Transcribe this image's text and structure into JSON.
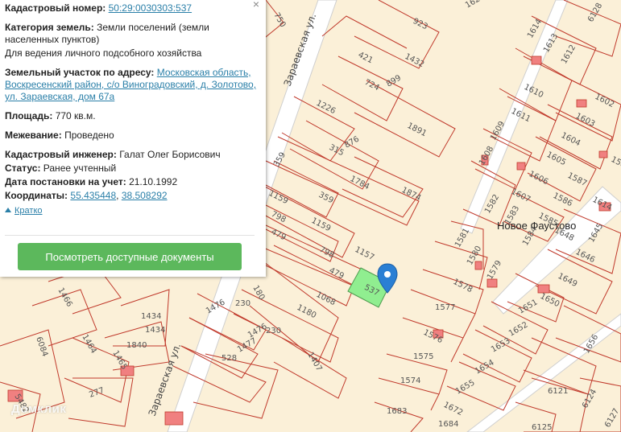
{
  "panel": {
    "cadastral_label": "Кадастровый номер:",
    "cadastral_value": "50:29:0030303:537",
    "category_label": "Категория земель:",
    "category_value": "Земли поселений (земли населенных пунктов)",
    "use_value": "Для ведения личного подсобного хозяйства",
    "address_label": "Земельный участок по адресу:",
    "address_value": "Московская область, Воскресенский район, с/о Виноградовский, д. Золотово, ул. Зараевская, дом 67а",
    "area_label": "Площадь:",
    "area_value": "770 кв.м.",
    "survey_label": "Межевание:",
    "survey_value": "Проведено",
    "engineer_label": "Кадастровый инженер:",
    "engineer_value": "Галат Олег Борисович",
    "status_label": "Статус:",
    "status_value": "Ранее учтенный",
    "date_label": "Дата постановки на учет:",
    "date_value": "21.10.1992",
    "coords_label": "Координаты:",
    "coords_lat": "55.435448",
    "coords_sep": ", ",
    "coords_lon": "38.508292",
    "collapse_label": "Кратко",
    "docs_button": "Посмотреть доступные документы",
    "close_symbol": "×"
  },
  "map": {
    "street_1": "Зараевская ул.",
    "street_2": "Зараевская ул.",
    "place": "Новое Фаустово",
    "selected_plot": "537",
    "watermark": "Домклик",
    "plots": [
      "750",
      "923",
      "1432",
      "421",
      "724",
      "899",
      "1891",
      "1226",
      "876",
      "315",
      "1784",
      "1874",
      "359",
      "359",
      "1159",
      "1159",
      "798",
      "479",
      "798",
      "479",
      "1157",
      "1068",
      "1180",
      "1407",
      "230",
      "230",
      "1476",
      "1476",
      "1477",
      "528",
      "180",
      "1466",
      "1434",
      "1434",
      "1840",
      "1464",
      "1465",
      "6084",
      "277",
      "5482",
      "1683",
      "1684",
      "1672",
      "1574",
      "1575",
      "1576",
      "1577",
      "1578",
      "1579",
      "1580",
      "1581",
      "1582",
      "1583",
      "1584",
      "1585",
      "1586",
      "1587",
      "1588",
      "1602",
      "1603",
      "1604",
      "1605",
      "1606",
      "1607",
      "1608",
      "1609",
      "1610",
      "1611",
      "1612",
      "1613",
      "1614",
      "1614",
      "1645",
      "1646",
      "1648",
      "1649",
      "1650",
      "1651",
      "1652",
      "1653",
      "1654",
      "1655",
      "1656",
      "6121",
      "6124",
      "6125",
      "6127",
      "6128",
      "1626",
      "1625"
    ],
    "colors": {
      "background": "#fbf0d8",
      "plot_stroke": "#c0392b",
      "road": "#ffffff",
      "selected_fill": "#90ee90",
      "marker": "#2a7fd4",
      "building": "#f08080"
    }
  }
}
